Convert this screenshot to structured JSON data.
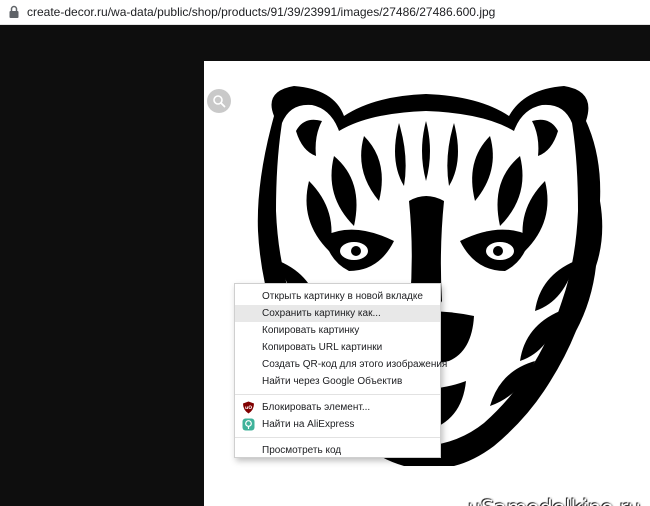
{
  "address_bar": {
    "url": "create-decor.ru/wa-data/public/shop/products/91/39/23991/images/27486/27486.600.jpg"
  },
  "viewer": {
    "zoom_icon": "magnifier-icon",
    "watermark": "uSamodelkino.ru"
  },
  "context_menu": {
    "items": [
      {
        "label": "Открыть картинку в новой вкладке"
      },
      {
        "label": "Сохранить картинку как..."
      },
      {
        "label": "Копировать картинку"
      },
      {
        "label": "Копировать URL картинки"
      },
      {
        "label": "Создать QR-код для этого изображения"
      },
      {
        "label": "Найти через Google Объектив"
      }
    ],
    "extension_items": [
      {
        "label": "Блокировать элемент...",
        "icon": "ublock-shield-icon",
        "color": "#800000"
      },
      {
        "label": "Найти на AliExpress",
        "icon": "aliexpress-helper-icon",
        "color": "#3fb29a"
      }
    ],
    "inspect_label": "Просмотреть код"
  },
  "colors": {
    "background": "#0e0e0e",
    "menu_hover": "#e8e8e8"
  }
}
